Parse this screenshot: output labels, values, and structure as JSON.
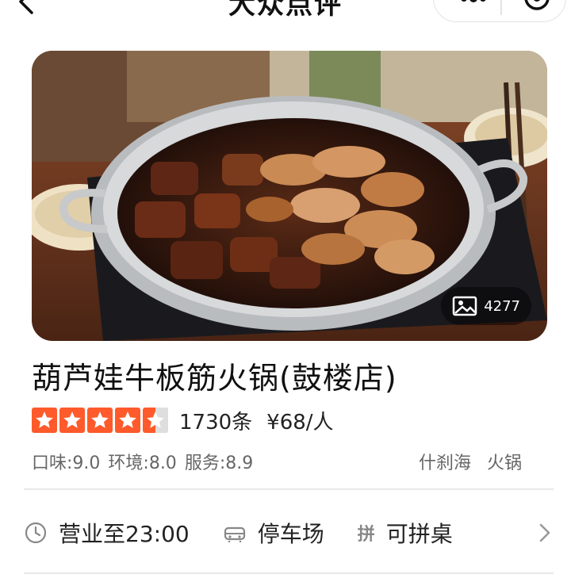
{
  "nav": {
    "title": "大众点评"
  },
  "hero": {
    "photo_count": "4277"
  },
  "shop": {
    "name": "葫芦娃牛板筋火锅(鼓楼店)",
    "rating_stars": 4.5,
    "review_count": "1730条",
    "avg_price": "¥68/人",
    "scores": {
      "taste": "口味:9.0",
      "environment": "环境:8.0",
      "service": "服务:8.9"
    },
    "tags": [
      "什刹海",
      "火锅"
    ]
  },
  "info": {
    "hours": "营业至23:00",
    "parking": "停车场",
    "shared_table_icon": "拼",
    "shared_table": "可拼桌"
  },
  "colors": {
    "star": "#ff5a2b",
    "star_empty": "#dedede",
    "text_secondary": "#666666"
  }
}
